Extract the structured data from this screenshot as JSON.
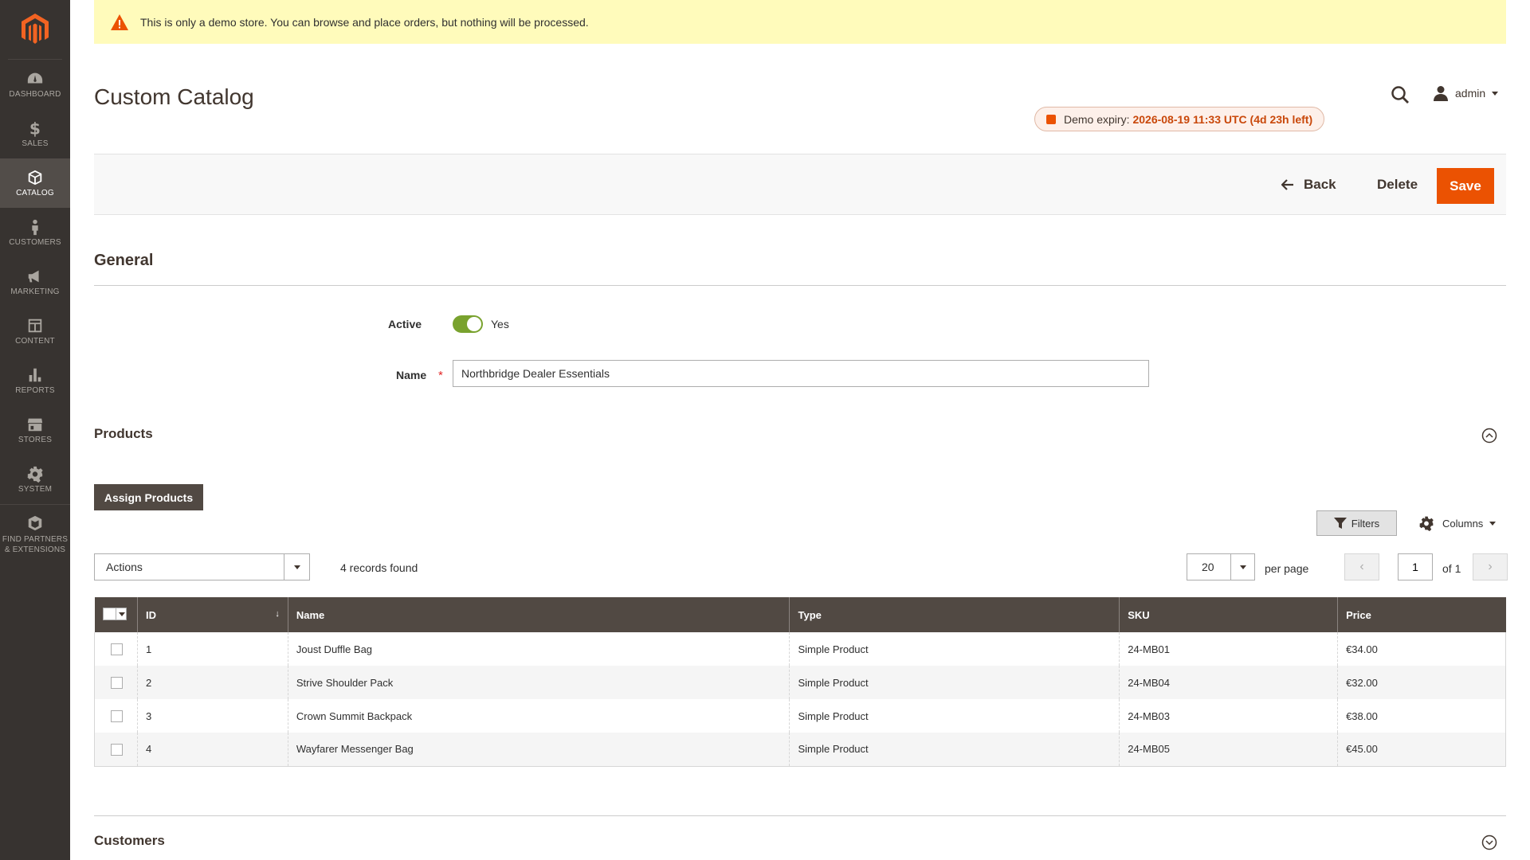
{
  "notice": {
    "text": "This is only a demo store. You can browse and place orders, but nothing will be processed."
  },
  "sidebar": {
    "items": [
      {
        "label": "DASHBOARD",
        "icon": "dashboard-icon"
      },
      {
        "label": "SALES",
        "icon": "dollar-icon"
      },
      {
        "label": "CATALOG",
        "icon": "box-icon",
        "active": true
      },
      {
        "label": "CUSTOMERS",
        "icon": "person-icon"
      },
      {
        "label": "MARKETING",
        "icon": "megaphone-icon"
      },
      {
        "label": "CONTENT",
        "icon": "layout-icon"
      },
      {
        "label": "REPORTS",
        "icon": "bar-chart-icon"
      },
      {
        "label": "STORES",
        "icon": "store-icon"
      },
      {
        "label": "SYSTEM",
        "icon": "gear-icon"
      }
    ],
    "partners": {
      "line1": "FIND PARTNERS",
      "line2": "& EXTENSIONS"
    }
  },
  "header": {
    "title": "Custom Catalog",
    "user": "admin",
    "expiry": {
      "label": "Demo expiry:",
      "value": "2026-08-19 11:33 UTC (4d 23h left)"
    }
  },
  "toolbar": {
    "back_label": "Back",
    "delete_label": "Delete",
    "save_label": "Save"
  },
  "general": {
    "title": "General",
    "active_label": "Active",
    "active_value": "Yes",
    "name_label": "Name",
    "name_value": "Northbridge Dealer Essentials"
  },
  "products": {
    "title": "Products",
    "assign_label": "Assign Products",
    "filters_label": "Filters",
    "columns_label": "Columns",
    "actions_label": "Actions",
    "records_found": "4 records found",
    "per_page_value": "20",
    "per_page_label": "per page",
    "page_value": "1",
    "page_of": "of 1",
    "columns": [
      "ID",
      "Name",
      "Type",
      "SKU",
      "Price"
    ],
    "rows": [
      {
        "id": "1",
        "name": "Joust Duffle Bag",
        "type": "Simple Product",
        "sku": "24-MB01",
        "price": "€34.00"
      },
      {
        "id": "2",
        "name": "Strive Shoulder Pack",
        "type": "Simple Product",
        "sku": "24-MB04",
        "price": "€32.00"
      },
      {
        "id": "3",
        "name": "Crown Summit Backpack",
        "type": "Simple Product",
        "sku": "24-MB03",
        "price": "€38.00"
      },
      {
        "id": "4",
        "name": "Wayfarer Messenger Bag",
        "type": "Simple Product",
        "sku": "24-MB05",
        "price": "€45.00"
      }
    ]
  },
  "customers": {
    "title": "Customers"
  },
  "colors": {
    "accent": "#eb5202",
    "sidebar": "#373330",
    "grid_header": "#514943",
    "toggle_on": "#79a22e",
    "notice_bg": "#fffbbb"
  }
}
